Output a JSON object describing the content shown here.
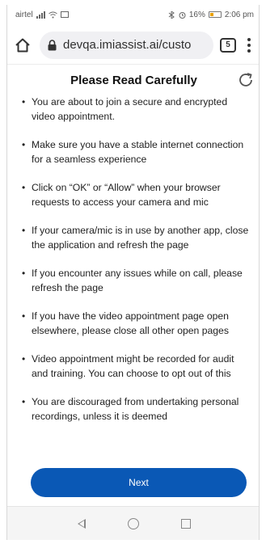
{
  "status_bar": {
    "carrier": "airtel",
    "battery": "16%",
    "time": "2:06 pm"
  },
  "browser": {
    "url": "devqa.imiassist.ai/custo",
    "tab_count": "5"
  },
  "page": {
    "title": "Please Read Carefully",
    "notes": [
      "You are about to join a secure and encrypted video appointment.",
      "Make sure you have a stable internet connection for a seamless experience",
      "Click on “OK” or “Allow” when your browser requests to access your camera and mic",
      "If your camera/mic is in use by another app, close the application and refresh the page",
      "If you encounter any issues while on call, please refresh the page",
      "If you have the video appointment page open elsewhere, please close all other open pages",
      "Video appointment might be recorded for audit and training. You can choose to opt out of this",
      "You are discouraged from undertaking personal recordings, unless it is deemed"
    ],
    "next_label": "Next"
  },
  "colors": {
    "accent": "#0a58b5"
  },
  "icons": {
    "home": "home-icon",
    "lock": "lock-icon",
    "menu": "more-vert-icon",
    "refresh": "refresh-icon",
    "nav_back": "back-icon",
    "nav_home": "home-circle-icon",
    "nav_recent": "recents-icon"
  }
}
